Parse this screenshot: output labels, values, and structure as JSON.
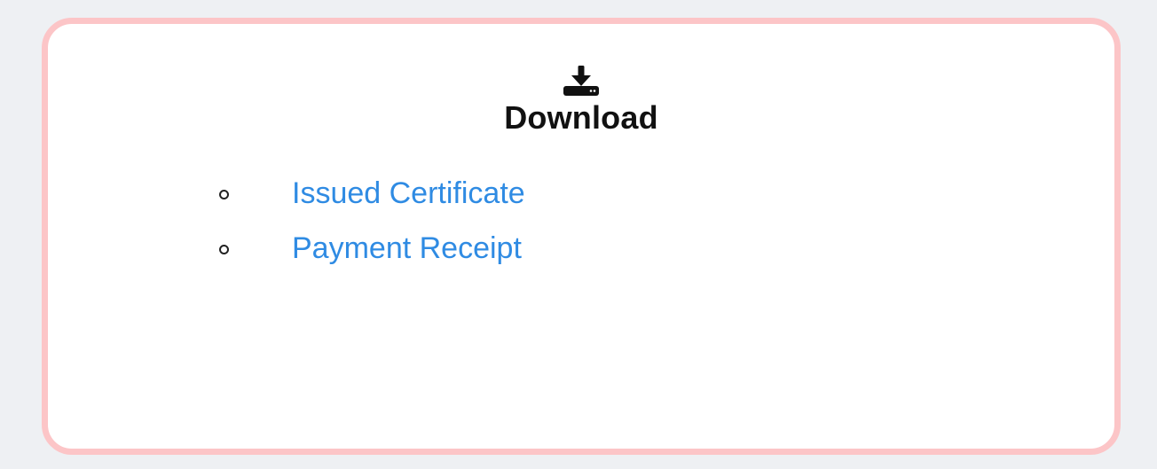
{
  "card": {
    "icon": "download-icon",
    "title": "Download",
    "links": [
      {
        "label": "Issued Certificate"
      },
      {
        "label": "Payment Receipt"
      }
    ]
  },
  "colors": {
    "background": "#eef0f3",
    "card_border": "#fcc5c7",
    "link": "#2f8be3",
    "title": "#111111"
  }
}
